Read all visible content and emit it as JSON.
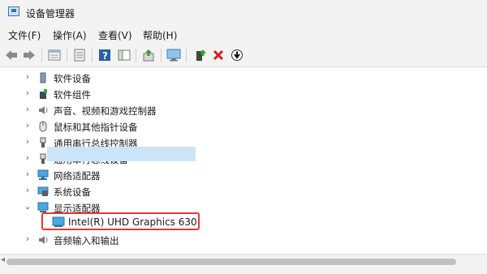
{
  "window": {
    "title": "设备管理器"
  },
  "menu": [
    "文件(F)",
    "操作(A)",
    "查看(V)",
    "帮助(H)"
  ],
  "toolbar": {
    "icons": [
      "back-icon",
      "forward-icon",
      "properties-icon",
      "refresh-view-icon",
      "help-icon",
      "console-tree-icon",
      "update-driver-icon",
      "scan-hardware-icon",
      "enable-device-icon",
      "uninstall-icon",
      "install-icon"
    ]
  },
  "tree": {
    "items": [
      {
        "label": "软件设备",
        "expanded": false
      },
      {
        "label": "软件组件",
        "expanded": false
      },
      {
        "label": "声音、视频和游戏控制器",
        "expanded": false
      },
      {
        "label": "鼠标和其他指针设备",
        "expanded": false
      },
      {
        "label": "通用串行总线控制器",
        "expanded": false
      },
      {
        "label": "通用串行总线设备",
        "expanded": false
      },
      {
        "label": "网络适配器",
        "expanded": false
      },
      {
        "label": "系统设备",
        "expanded": false
      },
      {
        "label": "显示适配器",
        "expanded": true
      },
      {
        "label": "音频输入和输出",
        "expanded": false
      }
    ],
    "child": {
      "label": "Intel(R) UHD Graphics 630"
    }
  },
  "colors": {
    "highlight": "#e53935",
    "selection": "#cce4f7"
  }
}
